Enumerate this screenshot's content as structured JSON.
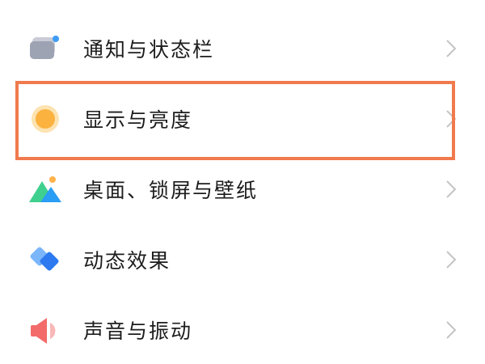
{
  "settings": {
    "items": [
      {
        "label": "通知与状态栏",
        "icon": "notification-status-bar-icon"
      },
      {
        "label": "显示与亮度",
        "icon": "display-brightness-icon"
      },
      {
        "label": "桌面、锁屏与壁纸",
        "icon": "wallpaper-mountain-icon"
      },
      {
        "label": "动态效果",
        "icon": "animation-diamond-icon"
      },
      {
        "label": "声音与振动",
        "icon": "speaker-sound-icon"
      }
    ],
    "highlighted_index": 1
  },
  "colors": {
    "highlight_border": "#f07a4e",
    "chevron": "#c4c4c4",
    "label_text": "#1c1c1c"
  }
}
